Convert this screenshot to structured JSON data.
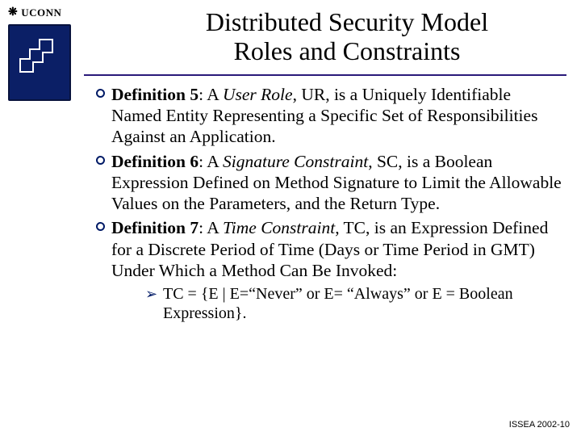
{
  "header": {
    "brand": "UCONN",
    "title_line1": "Distributed Security Model",
    "title_line2": "Roles and Constraints"
  },
  "bullets": [
    {
      "def_label": "Definition 5",
      "sep": ": A ",
      "term": "User Role",
      "tail": ", UR, is a Uniquely Identifiable Named Entity Representing a Specific Set of Responsibilities Against an Application."
    },
    {
      "def_label": "Definition 6",
      "sep": ": A ",
      "term": "Signature Constraint",
      "tail": ", SC, is a Boolean Expression Defined on Method Signature to Limit the Allowable Values on the Parameters, and the Return Type."
    },
    {
      "def_label": "Definition 7",
      "sep": ": A ",
      "term": "Time Constraint",
      "tail": ", TC, is an Expression Defined for a Discrete Period of Time (Days or Time Period in GMT) Under Which a Method Can Be Invoked:"
    }
  ],
  "subbullet": {
    "text": "TC = {E | E=“Never” or E= “Always” or E = Boolean Expression}."
  },
  "footer": {
    "text": "ISSEA 2002-10"
  }
}
